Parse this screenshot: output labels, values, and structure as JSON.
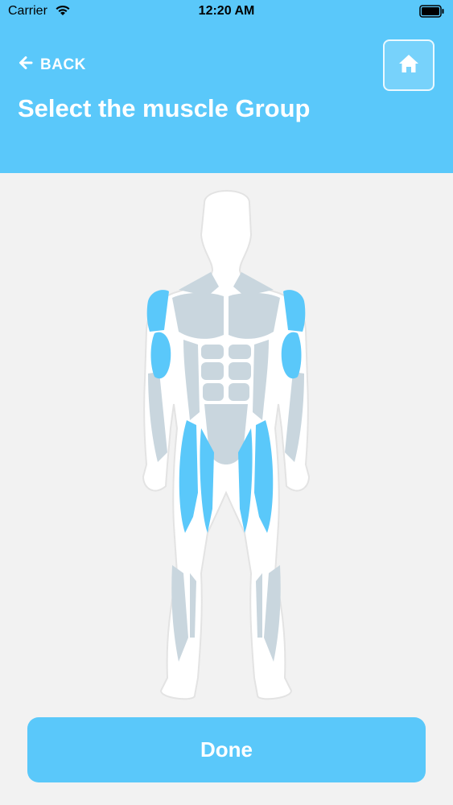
{
  "status_bar": {
    "carrier": "Carrier",
    "time": "12:20 AM",
    "wifi_icon": "wifi-icon",
    "battery_icon": "battery-icon"
  },
  "header": {
    "back_label": "BACK",
    "back_icon": "arrow-left-icon",
    "home_icon": "home-icon",
    "title": "Select the muscle Group",
    "background_color": "#5ac8fa"
  },
  "muscle_map": {
    "selected_color": "#5ac8fa",
    "unselected_color": "#c9d6de",
    "selected_groups": [
      "shoulders",
      "biceps",
      "quadriceps"
    ],
    "unselected_groups": [
      "chest",
      "traps",
      "abs",
      "obliques",
      "forearms",
      "calves",
      "shins"
    ]
  },
  "footer": {
    "done_label": "Done"
  }
}
